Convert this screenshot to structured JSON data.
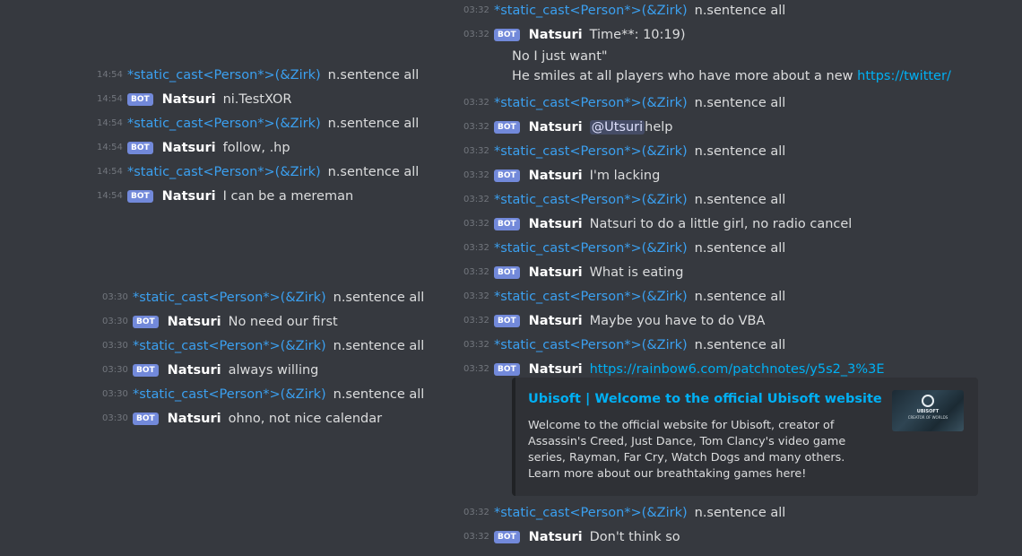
{
  "colors": {
    "background": "#36393f",
    "author_link": "#3ba0f0",
    "bot_badge": "#7289da",
    "link": "#00b0f4",
    "embed_bg": "#2f3136"
  },
  "bot_badge": "BOT",
  "author_user": "*static_cast<Person*>(&Zirk)",
  "author_bot": "Natsuri",
  "left_top": [
    {
      "ts": "14:54",
      "type": "user",
      "text": "n.sentence all"
    },
    {
      "ts": "14:54",
      "type": "bot",
      "text": "ni.TestXOR"
    },
    {
      "ts": "14:54",
      "type": "user",
      "text": "n.sentence all"
    },
    {
      "ts": "14:54",
      "type": "bot",
      "text": "follow, .hp"
    },
    {
      "ts": "14:54",
      "type": "user",
      "text": "n.sentence all"
    },
    {
      "ts": "14:54",
      "type": "bot",
      "text": "I can be a mereman"
    }
  ],
  "left_bottom": [
    {
      "ts": "03:30",
      "type": "user",
      "text": "n.sentence all"
    },
    {
      "ts": "03:30",
      "type": "bot",
      "text": "No need our first"
    },
    {
      "ts": "03:30",
      "type": "user",
      "text": "n.sentence all"
    },
    {
      "ts": "03:30",
      "type": "bot",
      "text": "always willing"
    },
    {
      "ts": "03:30",
      "type": "user",
      "text": "n.sentence all"
    },
    {
      "ts": "03:30",
      "type": "bot",
      "text": "ohno, not nice calendar"
    }
  ],
  "right": {
    "ts": "03:32",
    "first_user_text": "n.sentence all",
    "bot1_text": "Time**: 10:19)",
    "bot1_line2": "No I just want\"",
    "bot1_line3_text": "He smiles at all players who have more about a new ",
    "bot1_line3_link": "https://twitter/",
    "messages": [
      {
        "type": "user",
        "text": "n.sentence all"
      },
      {
        "type": "bot",
        "mention": "@Utsuri",
        "text": " help"
      },
      {
        "type": "user",
        "text": "n.sentence all"
      },
      {
        "type": "bot",
        "text": "I'm lacking"
      },
      {
        "type": "user",
        "text": "n.sentence all"
      },
      {
        "type": "bot",
        "text": "Natsuri to do a little girl, no radio cancel"
      },
      {
        "type": "user",
        "text": "n.sentence all"
      },
      {
        "type": "bot",
        "text": "What is eating"
      },
      {
        "type": "user",
        "text": "n.sentence all"
      },
      {
        "type": "bot",
        "text": "Maybe you have to do VBA"
      },
      {
        "type": "user",
        "text": "n.sentence all"
      },
      {
        "type": "bot",
        "link": "https://rainbow6.com/patchnotes/y5s2_3%3E"
      }
    ],
    "embed": {
      "title": "Ubisoft | Welcome to the official Ubisoft website",
      "description": "Welcome to the official website for Ubisoft, creator of Assassin's Creed, Just Dance, Tom Clancy's video game series, Rayman, Far Cry, Watch Dogs and many others. Learn more about our breathtaking games here!",
      "thumb_brand": "UBISOFT",
      "thumb_tagline": "CREATOR OF WORLDS"
    },
    "after": [
      {
        "type": "user",
        "text": "n.sentence all"
      },
      {
        "type": "bot",
        "text": "Don't think so"
      }
    ]
  }
}
